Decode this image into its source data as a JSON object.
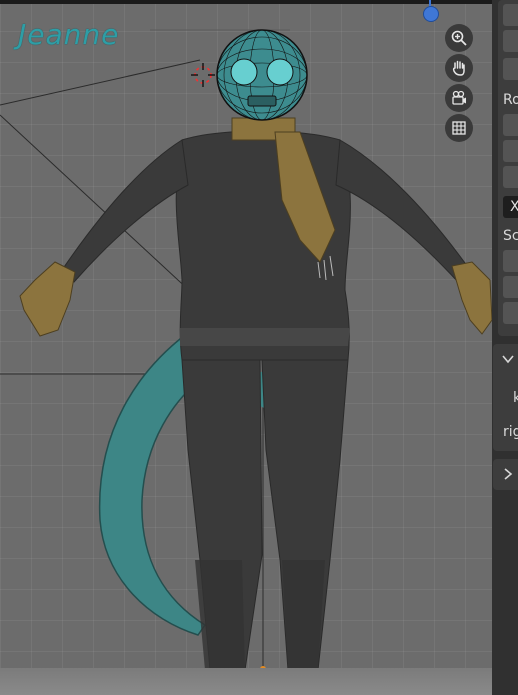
{
  "viewport": {
    "object_name": "Jeanne",
    "nav_buttons": [
      {
        "name": "zoom-icon"
      },
      {
        "name": "hand-pan-icon"
      },
      {
        "name": "camera-view-icon"
      },
      {
        "name": "grid-view-icon"
      }
    ]
  },
  "sidebar": {
    "rotation_label": "Ro",
    "x_label": "X",
    "scale_label": "Sc",
    "panel2_k_label": "k",
    "panel2_rig_label": "rig"
  },
  "colors": {
    "accent_name": "#2e9ea6",
    "gizmo_z": "#3f77d6",
    "body": "#3a3a3a",
    "scarf": "#8c743e",
    "tail": "#3d8686"
  }
}
